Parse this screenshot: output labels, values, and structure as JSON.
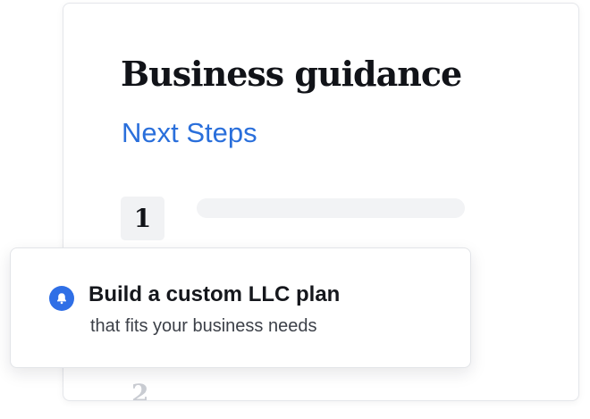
{
  "card": {
    "title": "Business guidance",
    "subtitle": "Next Steps",
    "steps": [
      {
        "number": "1"
      },
      {
        "number": "2"
      }
    ]
  },
  "notification": {
    "icon": "bell-icon",
    "title": "Build a custom LLC plan",
    "subtitle": "that fits your business needs"
  },
  "colors": {
    "accent": "#2a6fdb",
    "icon_bg": "#2f6fe6",
    "text_dark": "#111318",
    "text_muted": "#3c4048"
  }
}
